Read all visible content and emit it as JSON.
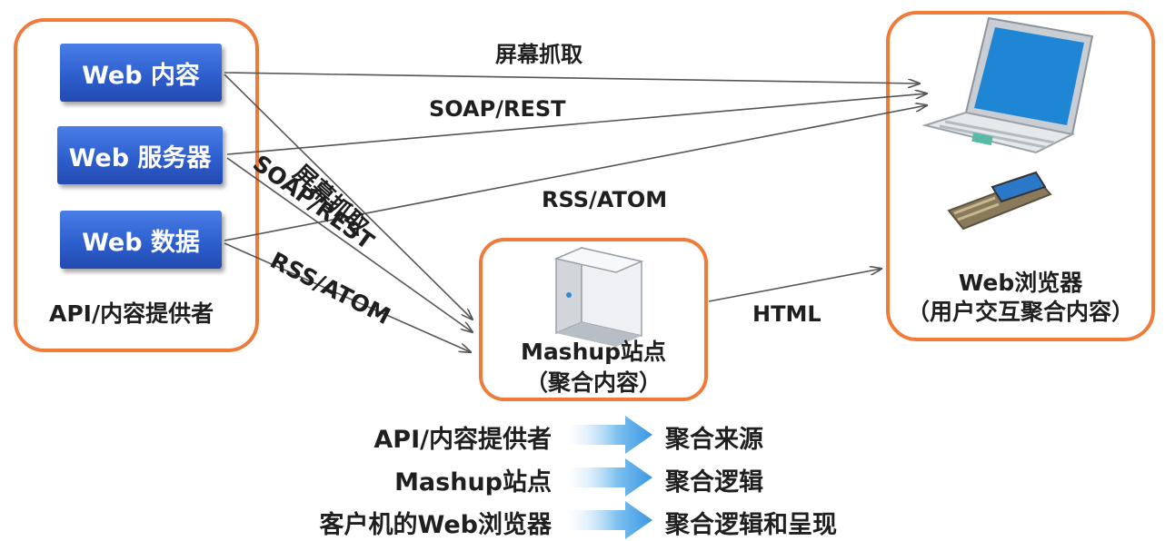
{
  "sources": {
    "items": [
      {
        "label": "Web 内容"
      },
      {
        "label": "Web 服务器"
      },
      {
        "label": "Web 数据"
      }
    ],
    "caption": "API/内容提供者"
  },
  "mashup": {
    "name": "Mashup站点",
    "subtitle": "（聚合内容）"
  },
  "browser": {
    "name": "Web浏览器",
    "subtitle": "（用户交互聚合内容）"
  },
  "arrows": {
    "top_screen": "屏幕抓取",
    "top_soap": "SOAP/REST",
    "top_rss": "RSS/ATOM",
    "diag_screen": "屏幕抓取",
    "diag_soap": "SOAP/REST",
    "diag_rss": "RSS/ATOM",
    "html": "HTML"
  },
  "legend": [
    {
      "left": "API/内容提供者",
      "right": "聚合来源"
    },
    {
      "left": "Mashup站点",
      "right": "聚合逻辑"
    },
    {
      "left": "客户机的Web浏览器",
      "right": "聚合逻辑和呈现"
    }
  ],
  "colors": {
    "accent_border": "#ee7b3a",
    "button_blue": "#2e5fcf",
    "arrow_blue": "#4aa3e8"
  }
}
